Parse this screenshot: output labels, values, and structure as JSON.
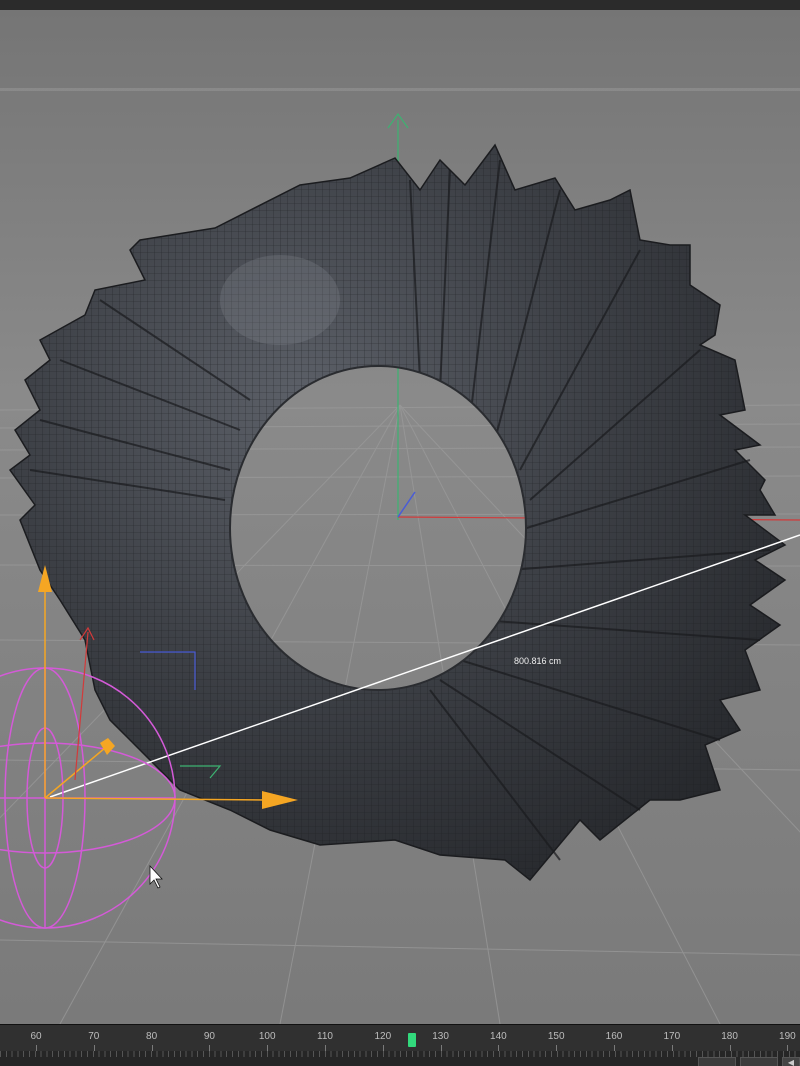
{
  "viewport": {
    "measurement_label": "800.816 cm",
    "colors": {
      "background": "#7d7d7d",
      "mesh": "#3b3e44",
      "y_axis": "#3cb371",
      "x_axis": "#d23a3a",
      "z_axis": "#4a5cd6",
      "handle": "#f5a623",
      "light_gizmo": "#d45ad8",
      "measure_line": "#ffffff"
    }
  },
  "timeline": {
    "ticks": [
      "60",
      "70",
      "80",
      "90",
      "100",
      "110",
      "120",
      "130",
      "140",
      "150",
      "160",
      "170",
      "180",
      "190"
    ],
    "current_frame": 125,
    "playhead_color": "#32d97c"
  }
}
